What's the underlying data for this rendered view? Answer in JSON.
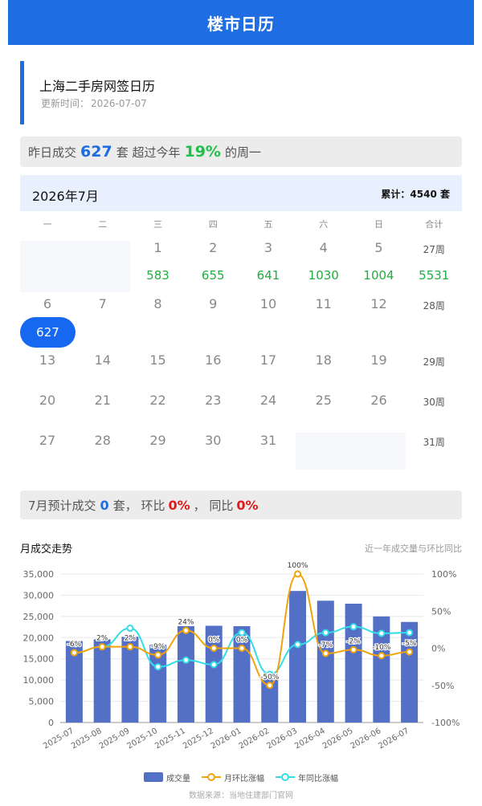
{
  "header": {
    "title": "楼市日历"
  },
  "info": {
    "title": "上海二手房网签日历",
    "update_label": "更新时间：",
    "update_date": "2026-07-07"
  },
  "yesterday": {
    "prefix": "昨日成交",
    "count": "627",
    "unit": "套 超过今年",
    "percent": "19%",
    "suffix": "的周一"
  },
  "calendar": {
    "month": "2026年7月",
    "total": "累计：4540 套",
    "weekdays": [
      "一",
      "二",
      "三",
      "四",
      "五",
      "六",
      "日",
      "合计"
    ],
    "weeks": [
      {
        "days": [
          "",
          "",
          "1",
          "2",
          "3",
          "4",
          "5"
        ],
        "values": [
          "",
          "",
          "583",
          "655",
          "641",
          "1030",
          "1004"
        ],
        "week_label": "27周",
        "sum": "5531"
      },
      {
        "days": [
          "6",
          "7",
          "8",
          "9",
          "10",
          "11",
          "12"
        ],
        "values": [
          "627",
          "",
          "",
          "",
          "",
          "",
          ""
        ],
        "week_label": "28周",
        "sum": ""
      },
      {
        "days": [
          "13",
          "14",
          "15",
          "16",
          "17",
          "18",
          "19"
        ],
        "values": [
          "",
          "",
          "",
          "",
          "",
          "",
          ""
        ],
        "week_label": "29周",
        "sum": ""
      },
      {
        "days": [
          "20",
          "21",
          "22",
          "23",
          "24",
          "25",
          "26"
        ],
        "values": [
          "",
          "",
          "",
          "",
          "",
          "",
          ""
        ],
        "week_label": "30周",
        "sum": ""
      },
      {
        "days": [
          "27",
          "28",
          "29",
          "30",
          "31",
          "",
          ""
        ],
        "values": [
          "",
          "",
          "",
          "",
          "",
          "",
          ""
        ],
        "week_label": "31周",
        "sum": ""
      }
    ],
    "today": "627"
  },
  "forecast": {
    "prefix": "7月预计成交",
    "count": "0",
    "unit": "套，  环比",
    "mom": "0%",
    "sep": "，  同比",
    "yoy": "0%"
  },
  "chart_section": {
    "title": "月成交走势",
    "note": "近一年成交量与环比同比"
  },
  "chart_data": {
    "type": "bar",
    "categories": [
      "2025-07",
      "2025-08",
      "2025-09",
      "2025-10",
      "2025-11",
      "2025-12",
      "2026-01",
      "2026-02",
      "2026-03",
      "2026-04",
      "2026-05",
      "2026-06",
      "2026-07"
    ],
    "series": [
      {
        "name": "成交量",
        "kind": "bar",
        "axis": "left",
        "color": "#5470c6",
        "values": [
          19200,
          19600,
          20200,
          18300,
          22700,
          22800,
          22700,
          10500,
          31000,
          28700,
          28000,
          25000,
          23700
        ]
      },
      {
        "name": "月环比涨幅",
        "kind": "line",
        "axis": "right",
        "color": "#f0a30a",
        "values": [
          -6,
          2,
          2,
          -9,
          24,
          0,
          0,
          -50,
          100,
          -7,
          -2,
          -10,
          -5
        ],
        "labels": [
          "-6%",
          "2%",
          "2%",
          "-9%",
          "24%",
          "0%",
          "0%",
          "-50%",
          "100%",
          "-7%",
          "-2%",
          "-10%",
          "-5%"
        ]
      },
      {
        "name": "年同比涨幅",
        "kind": "line",
        "axis": "right",
        "color": "#33dde8",
        "values": [
          -6,
          2,
          27,
          -25,
          -16,
          -22,
          21,
          -35,
          5,
          21,
          29,
          20,
          21
        ]
      }
    ],
    "ylim_left": [
      0,
      35000
    ],
    "yticks_left": [
      "35,000",
      "30,000",
      "25,000",
      "20,000",
      "15,000",
      "10,000",
      "5,000",
      "0"
    ],
    "ylim_right": [
      -100,
      100
    ],
    "yticks_right": [
      "100%",
      "50%",
      "0%",
      "-50%",
      "-100%"
    ],
    "grid": true,
    "legend": "bottom"
  },
  "source": "数据来源：当地住建部门官网"
}
